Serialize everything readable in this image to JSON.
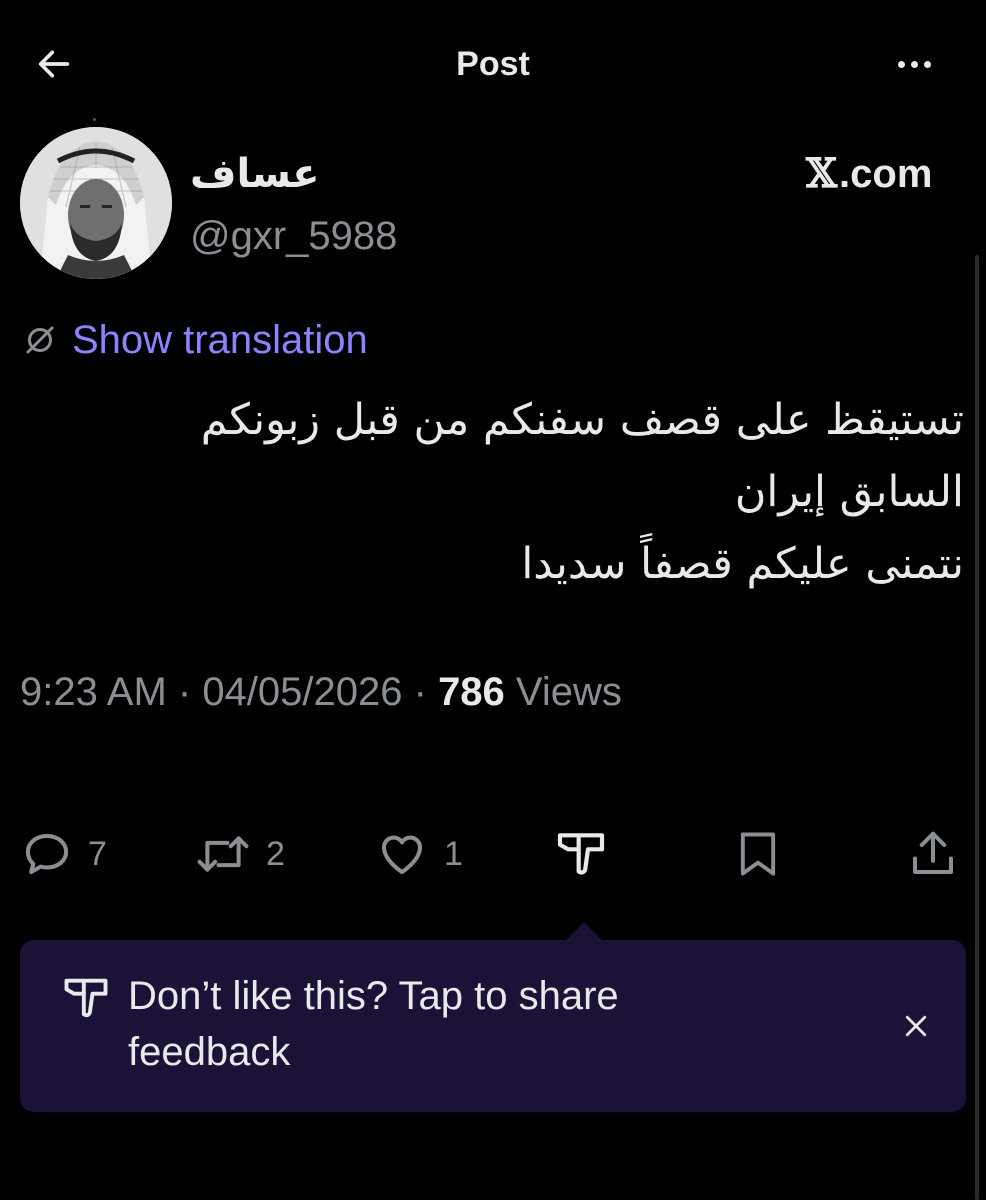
{
  "header": {
    "title": "Post",
    "back_icon": "arrow-left-icon",
    "more_icon": "more-horizontal-icon"
  },
  "author": {
    "display_name": "عساف",
    "handle": "@gxr_5988"
  },
  "source": {
    "label": "X.com",
    "logo": "𝕏",
    "suffix": ".com"
  },
  "translation": {
    "label": "Show translation",
    "icon": "translate-icon"
  },
  "tweet": {
    "lines": [
      "تستيقظ على قصف سفنكم من قبل زبونكم",
      "السابق إيران",
      "نتمنى عليكم  قصفاً سديدا"
    ]
  },
  "meta": {
    "time": "9:23 AM",
    "separator": " · ",
    "date": "04/05/2026",
    "views_count": "786",
    "views_label": " Views"
  },
  "actions": {
    "reply_count": "7",
    "repost_count": "2",
    "like_count": "1"
  },
  "feedback_popup": {
    "text": "Don’t like this? Tap to share feedback"
  },
  "colors": {
    "background": "#000000",
    "text_primary": "#e7e9ea",
    "text_secondary": "#8b8f94",
    "translation_accent": "#8e83ff",
    "popup_background": "#1c1238"
  }
}
